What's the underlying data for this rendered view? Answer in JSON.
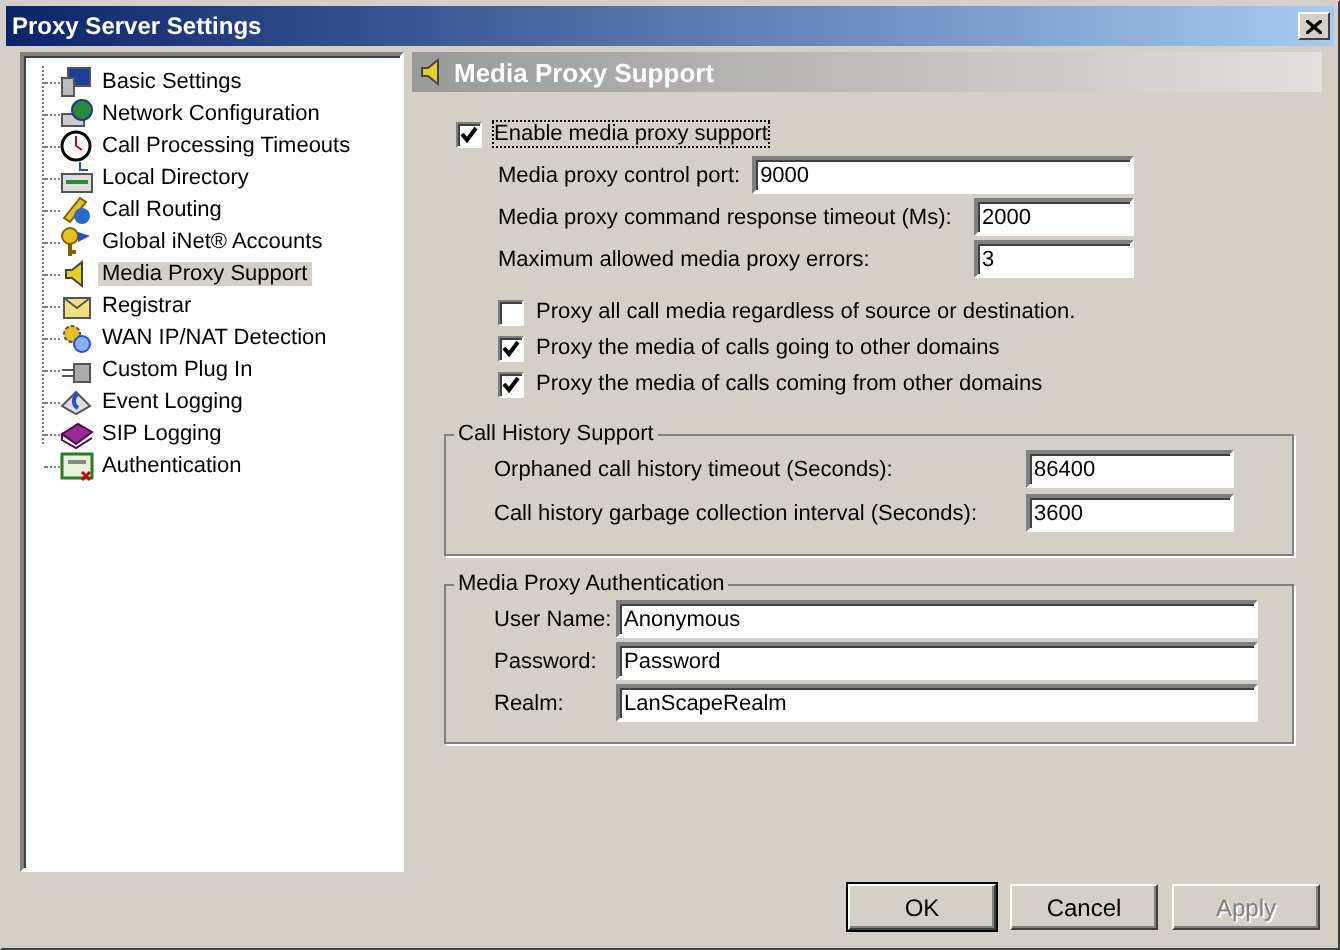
{
  "window": {
    "title": "Proxy Server Settings"
  },
  "tree": {
    "items": [
      {
        "label": "Basic Settings",
        "selected": false
      },
      {
        "label": "Network Configuration",
        "selected": false
      },
      {
        "label": "Call Processing Timeouts",
        "selected": false
      },
      {
        "label": "Local Directory",
        "selected": false
      },
      {
        "label": "Call Routing",
        "selected": false
      },
      {
        "label": "Global iNet® Accounts",
        "selected": false
      },
      {
        "label": "Media Proxy Support",
        "selected": true
      },
      {
        "label": "Registrar",
        "selected": false
      },
      {
        "label": "WAN IP/NAT Detection",
        "selected": false
      },
      {
        "label": "Custom Plug In",
        "selected": false
      },
      {
        "label": "Event Logging",
        "selected": false
      },
      {
        "label": "SIP Logging",
        "selected": false
      },
      {
        "label": "Authentication",
        "selected": false
      }
    ]
  },
  "panel": {
    "title": "Media Proxy Support"
  },
  "enable": {
    "label": "Enable media proxy support",
    "checked": true
  },
  "proxy_fields": [
    {
      "label": "Media proxy control port:",
      "value": "9000"
    },
    {
      "label": "Media proxy command response timeout (Ms):",
      "value": "2000"
    },
    {
      "label": "Maximum allowed media proxy errors:",
      "value": "3"
    }
  ],
  "options": [
    {
      "label": "Proxy all call media regardless of source or destination.",
      "checked": false
    },
    {
      "label": "Proxy the media of calls going to other domains",
      "checked": true
    },
    {
      "label": "Proxy the media of calls coming from other domains",
      "checked": true
    }
  ],
  "call_history": {
    "title": "Call History Support",
    "fields": [
      {
        "label": "Orphaned call history timeout (Seconds):",
        "value": "86400"
      },
      {
        "label": "Call history garbage collection interval (Seconds):",
        "value": "3600"
      }
    ]
  },
  "authentication": {
    "title": "Media Proxy Authentication",
    "fields": [
      {
        "label": "User Name:",
        "value": "Anonymous"
      },
      {
        "label": "Password:",
        "value": "Password"
      },
      {
        "label": "Realm:",
        "value": "LanScapeRealm"
      }
    ]
  },
  "buttons": [
    {
      "label": "OK",
      "default": true,
      "disabled": false
    },
    {
      "label": "Cancel",
      "default": false,
      "disabled": false
    },
    {
      "label": "Apply",
      "default": false,
      "disabled": true
    }
  ]
}
